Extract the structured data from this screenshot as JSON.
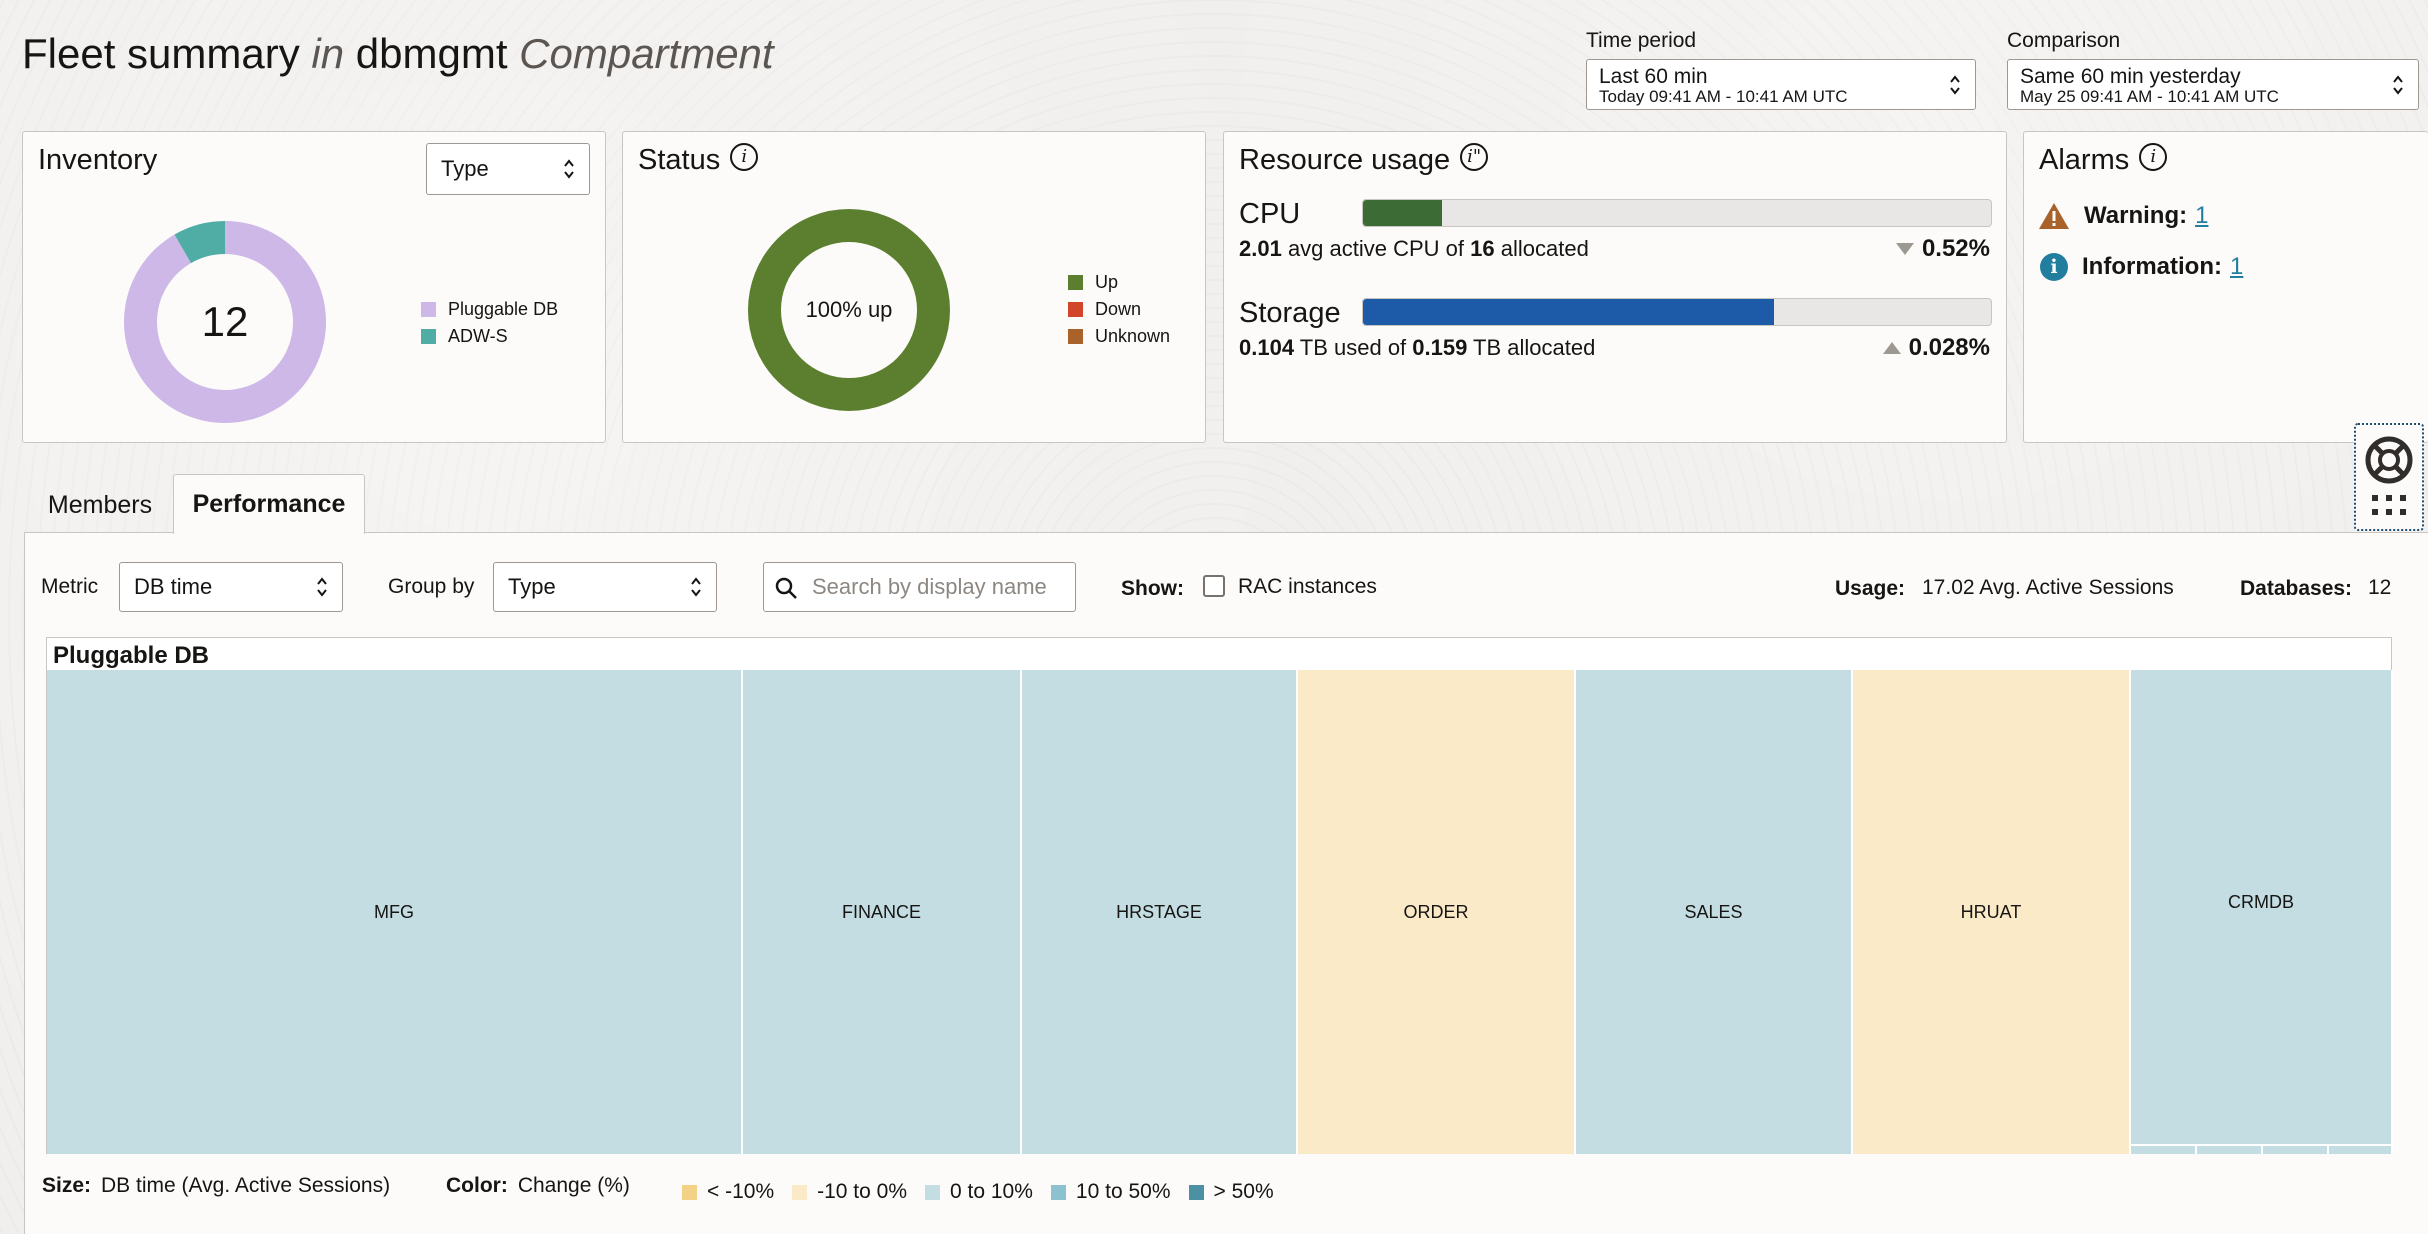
{
  "header": {
    "title_prefix": "Fleet summary",
    "title_in": "in",
    "title_name": "dbmgmt",
    "title_suffix": "Compartment",
    "time_period": {
      "label": "Time period",
      "value": "Last 60 min",
      "range": "Today 09:41 AM - 10:41 AM UTC"
    },
    "comparison": {
      "label": "Comparison",
      "value": "Same 60 min yesterday",
      "range": "May 25 09:41 AM - 10:41 AM UTC"
    }
  },
  "inventory": {
    "title": "Inventory",
    "select_value": "Type",
    "total": "12",
    "legend": [
      {
        "label": "Pluggable DB",
        "color": "#cdb8e8",
        "count": 11
      },
      {
        "label": "ADW-S",
        "color": "#4fada6",
        "count": 1
      }
    ]
  },
  "status": {
    "title": "Status",
    "center_text": "100% up",
    "legend": [
      {
        "label": "Up",
        "color": "#5b7f2e",
        "count": 12
      },
      {
        "label": "Down",
        "color": "#d1452b",
        "count": 0
      },
      {
        "label": "Unknown",
        "color": "#a8622a",
        "count": 0
      }
    ]
  },
  "resource_usage": {
    "title": "Resource usage",
    "cpu": {
      "label": "CPU",
      "used": "2.01",
      "used_text": " avg active CPU of ",
      "allocated": "16",
      "allocated_text": " allocated",
      "change": "0.52%",
      "direction": "down",
      "fraction": 0.125,
      "color": "#3d6b35"
    },
    "storage": {
      "label": "Storage",
      "used": "0.104",
      "used_text": " TB used of ",
      "allocated": "0.159",
      "allocated_text": " TB allocated",
      "change": "0.028%",
      "direction": "up",
      "fraction": 0.654,
      "color": "#1d5aa8"
    }
  },
  "alarms": {
    "title": "Alarms",
    "warning_label": "Warning:",
    "warning_count": "1",
    "info_label": "Information:",
    "info_count": "1"
  },
  "tabs": [
    {
      "label": "Members"
    },
    {
      "label": "Performance"
    }
  ],
  "controls": {
    "metric_label": "Metric",
    "metric_value": "DB time",
    "group_by_label": "Group by",
    "group_by_value": "Type",
    "search_placeholder": "Search by display name",
    "show_label": "Show:",
    "rac_label": "RAC instances",
    "usage_label": "Usage:",
    "usage_value": "17.02 Avg. Active Sessions",
    "databases_label": "Databases:",
    "databases_value": "12"
  },
  "treemap": {
    "group_title": "Pluggable DB",
    "cells": [
      {
        "name": "MFG",
        "color": "#c3dde2"
      },
      {
        "name": "FINANCE",
        "color": "#c3dde2"
      },
      {
        "name": "HRSTAGE",
        "color": "#c3dde2"
      },
      {
        "name": "ORDER",
        "color": "#faeac8"
      },
      {
        "name": "SALES",
        "color": "#c3dde2"
      },
      {
        "name": "HRUAT",
        "color": "#faeac8"
      },
      {
        "name": "CRMDB",
        "color": "#c3dde2"
      }
    ]
  },
  "footer": {
    "size_label": "Size:",
    "size_value": "DB time (Avg. Active Sessions)",
    "color_label": "Color:",
    "color_value": "Change (%)",
    "legend": [
      {
        "label": "< -10%",
        "color": "#f3d287"
      },
      {
        "label": "-10 to 0%",
        "color": "#faeac8"
      },
      {
        "label": "0 to 10%",
        "color": "#c3dde2"
      },
      {
        "label": "10 to 50%",
        "color": "#8cc1cf"
      },
      {
        "label": "> 50%",
        "color": "#4b90a3"
      }
    ]
  }
}
